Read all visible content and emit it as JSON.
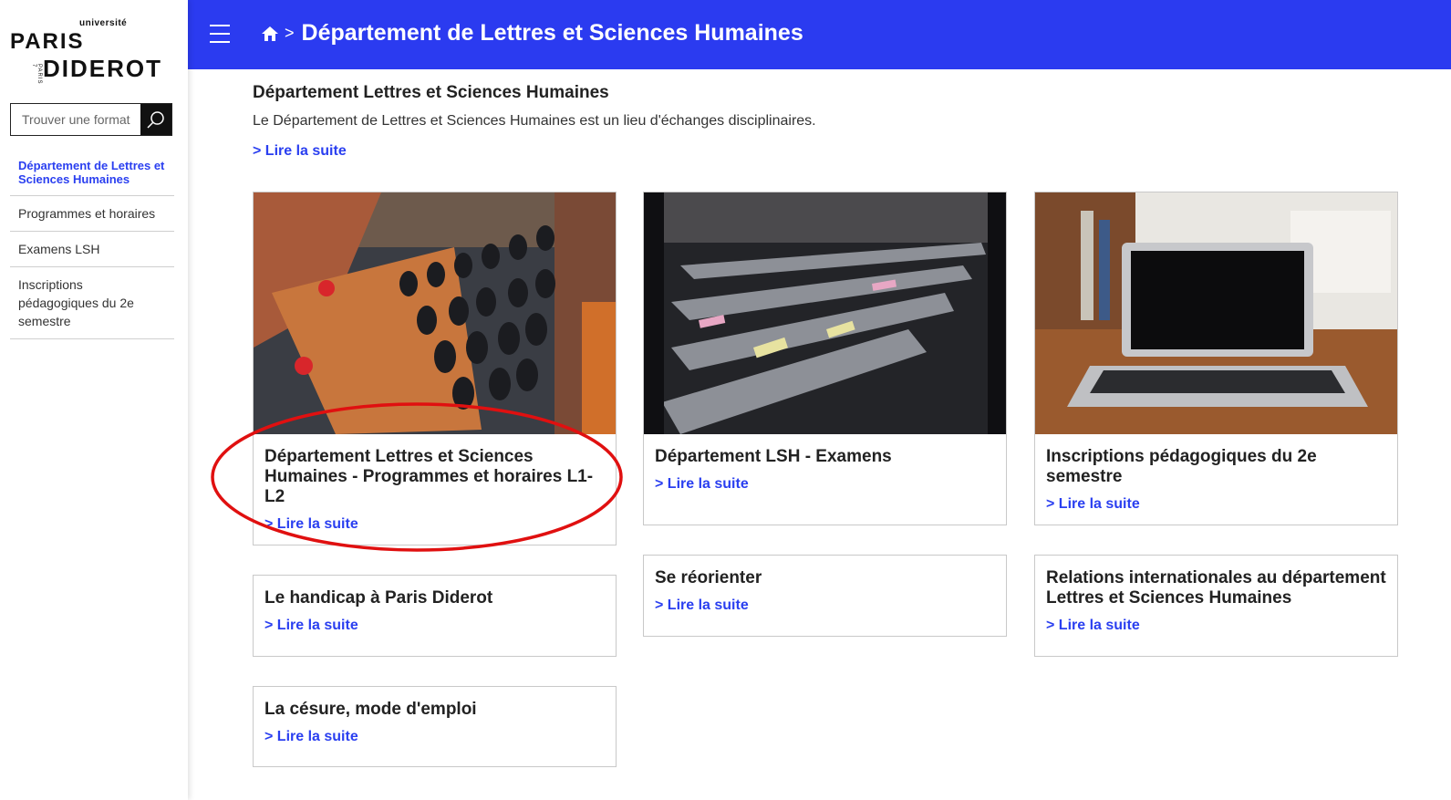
{
  "sidebar": {
    "logo": {
      "univ": "université",
      "paris": "PARIS",
      "diderot": "DIDEROT",
      "paris7": "PARIS 7"
    },
    "search": {
      "placeholder": "Trouver une format"
    },
    "items": [
      {
        "label": "Département de Lettres et Sciences Humaines"
      },
      {
        "label": "Programmes et horaires"
      },
      {
        "label": "Examens LSH"
      },
      {
        "label": "Inscriptions pédagogiques du 2e semestre"
      }
    ]
  },
  "header": {
    "breadcrumb_sep": ">",
    "title": "Département de Lettres et Sciences Humaines"
  },
  "intro": {
    "title": "Département Lettres et Sciences Humaines",
    "text": "Le Département de Lettres et Sciences Humaines est un lieu d'échanges disciplinaires.",
    "link": "> Lire la suite"
  },
  "cards": [
    {
      "title": "Département Lettres et Sciences Humaines - Programmes et horaires L1-L2",
      "link": "> Lire la suite"
    },
    {
      "title": "Département LSH - Examens",
      "link": "> Lire la suite"
    },
    {
      "title": "Inscriptions pédagogiques du 2e semestre",
      "link": "> Lire la suite"
    },
    {
      "title": "Le handicap à Paris Diderot",
      "link": "> Lire la suite"
    },
    {
      "title": "Se réorienter",
      "link": "> Lire la suite"
    },
    {
      "title": "Relations internationales au département Lettres et Sciences Humaines",
      "link": "> Lire la suite"
    },
    {
      "title": "La césure, mode d'emploi",
      "link": "> Lire la suite"
    }
  ],
  "colors": {
    "accent": "#2b3bf0",
    "link": "#2a3ff0",
    "annotation": "#e01010"
  },
  "icons": {
    "home": "home-icon",
    "search": "search-icon",
    "menu": "hamburger-menu-icon"
  }
}
